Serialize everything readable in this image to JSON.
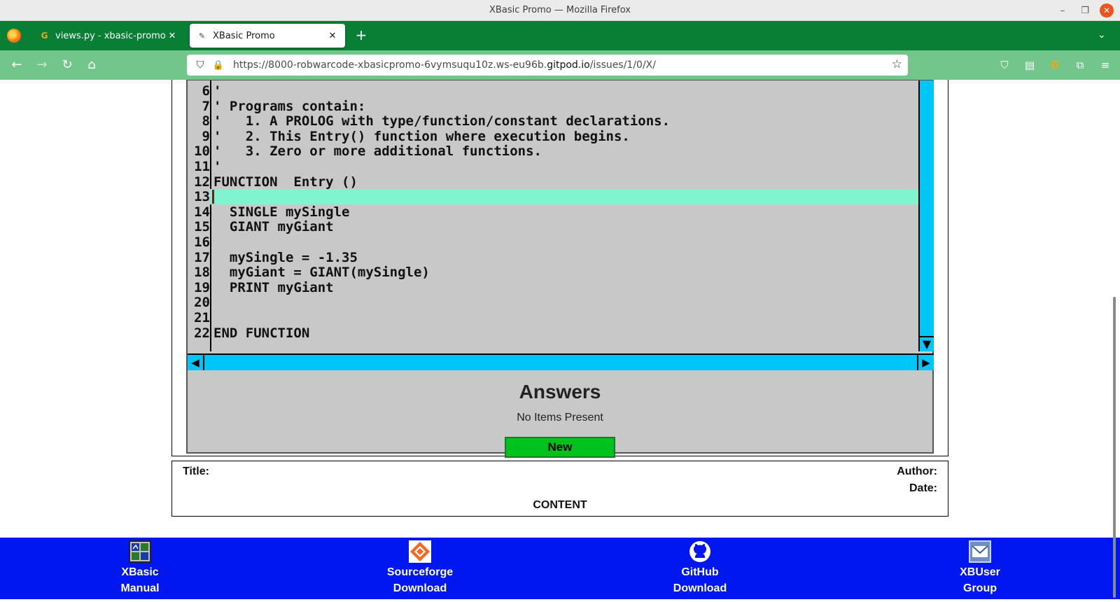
{
  "window": {
    "title": "XBasic Promo — Mozilla Firefox",
    "min": "–",
    "max": "❐",
    "close": "✕"
  },
  "tabs": [
    {
      "label": "views.py - xbasic-promo - Gi",
      "close": "✕",
      "favicon": "G"
    },
    {
      "label": "XBasic Promo",
      "close": "✕",
      "favicon": "✎"
    }
  ],
  "newtab": "+",
  "tablist": "⌄",
  "nav": {
    "back": "←",
    "forward": "→",
    "reload": "↻",
    "home": "⌂",
    "shield": "⛉",
    "lock": "🔒",
    "url_prefix": "https://8000-robwarcode-xbasicpromo-6vymsuqu10z.ws-eu96b.",
    "url_domain": "gitpod.io",
    "url_path": "/issues/1/0/X/",
    "star": "☆",
    "pocket": "⛉",
    "reader": "▤",
    "ext": "G",
    "puzzle": "⧉",
    "menu": "≡"
  },
  "code": {
    "lines": [
      {
        "n": "6",
        "t": "'"
      },
      {
        "n": "7",
        "t": "' Programs contain:"
      },
      {
        "n": "8",
        "t": "'   1. A PROLOG with type/function/constant declarations."
      },
      {
        "n": "9",
        "t": "'   2. This Entry() function where execution begins."
      },
      {
        "n": "10",
        "t": "'   3. Zero or more additional functions."
      },
      {
        "n": "11",
        "t": "'"
      },
      {
        "n": "12",
        "t": "FUNCTION  Entry ()"
      },
      {
        "n": "13",
        "t": ""
      },
      {
        "n": "14",
        "t": "  SINGLE mySingle"
      },
      {
        "n": "15",
        "t": "  GIANT myGiant"
      },
      {
        "n": "16",
        "t": ""
      },
      {
        "n": "17",
        "t": "  mySingle = -1.35"
      },
      {
        "n": "18",
        "t": "  myGiant = GIANT(mySingle)"
      },
      {
        "n": "19",
        "t": "  PRINT myGiant"
      },
      {
        "n": "20",
        "t": ""
      },
      {
        "n": "21",
        "t": ""
      },
      {
        "n": "22",
        "t": "END FUNCTION"
      }
    ],
    "highlight_line": "13",
    "down_arrow": "▼",
    "left_arrow": "◀",
    "right_arrow": "▶"
  },
  "answers": {
    "heading": "Answers",
    "empty_text": "No Items Present",
    "new_button": "New",
    "title_label": "Title:",
    "author_label": "Author:",
    "date_label": "Date:",
    "content_label": "CONTENT"
  },
  "footer": [
    {
      "line1": "XBasic",
      "line2": "Manual"
    },
    {
      "line1": "Sourceforge",
      "line2": "Download"
    },
    {
      "line1": "GitHub",
      "line2": "Download"
    },
    {
      "line1": "XBUser",
      "line2": "Group"
    }
  ]
}
